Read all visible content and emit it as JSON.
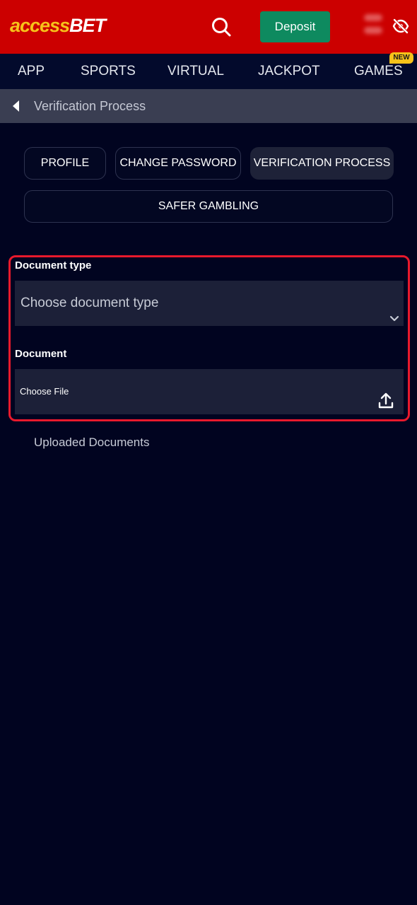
{
  "header": {
    "logo_part1": "access",
    "logo_part2": "BET",
    "deposit_label": "Deposit"
  },
  "nav": {
    "items": [
      {
        "label": "APP"
      },
      {
        "label": "SPORTS"
      },
      {
        "label": "VIRTUAL"
      },
      {
        "label": "JACKPOT"
      },
      {
        "label": "GAMES"
      }
    ],
    "new_badge": "NEW"
  },
  "breadcrumb": {
    "title": "Verification Process"
  },
  "tabs": {
    "profile": "PROFILE",
    "change_password": "CHANGE PASSWORD",
    "verification_process": "VERIFICATION PROCESS",
    "safer_gambling": "SAFER GAMBLING"
  },
  "form": {
    "document_type_label": "Document type",
    "document_type_placeholder": "Choose document type",
    "document_label": "Document",
    "choose_file_label": "Choose File"
  },
  "uploaded_documents_label": "Uploaded Documents",
  "colors": {
    "header_bg": "#cc0000",
    "accent_yellow": "#f6c21a",
    "deposit_green": "#0e8a5f",
    "highlight_red": "#e8192c",
    "page_bg": "#010420"
  },
  "icons": [
    "search-icon",
    "eye-off-icon",
    "back-arrow-icon",
    "chevron-down-icon",
    "upload-icon"
  ]
}
